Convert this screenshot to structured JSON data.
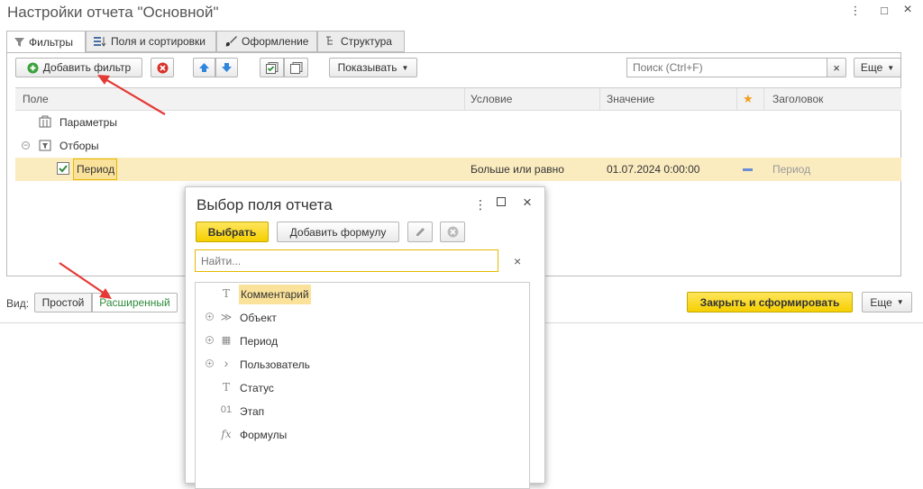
{
  "window": {
    "title": "Настройки отчета \"Основной\"",
    "more_icon": "⋮",
    "maximize_icon": "□",
    "close_icon": "×"
  },
  "tabs": [
    {
      "label": "Фильтры",
      "icon": "filter-icon",
      "active": true
    },
    {
      "label": "Поля и сортировки",
      "icon": "fields-icon",
      "active": false
    },
    {
      "label": "Оформление",
      "icon": "brush-icon",
      "active": false
    },
    {
      "label": "Структура",
      "icon": "structure-icon",
      "active": false
    }
  ],
  "toolbar": {
    "add_filter_label": "Добавить фильтр",
    "show_label": "Показывать",
    "search_placeholder": "Поиск (Ctrl+F)",
    "more_label": "Еще"
  },
  "grid": {
    "columns": {
      "field": "Поле",
      "condition": "Условие",
      "value": "Значение",
      "title": "Заголовок"
    },
    "rows": {
      "params": "Параметры",
      "filters": "Отборы",
      "period_field": "Период",
      "period_condition": "Больше или равно",
      "period_value": "01.07.2024 0:00:00",
      "period_title": "Период"
    }
  },
  "bottom": {
    "view_label": "Вид:",
    "simple": "Простой",
    "advanced": "Расширенный",
    "close_generate": "Закрыть и сформировать",
    "more_label": "Еще"
  },
  "popup": {
    "title": "Выбор поля отчета",
    "select_label": "Выбрать",
    "add_formula_label": "Добавить формулу",
    "find_placeholder": "Найти...",
    "clear_icon": "×",
    "items": [
      {
        "label": "Комментарий",
        "icon": "T",
        "expandable": false,
        "selected": true
      },
      {
        "label": "Объект",
        "icon": "≫",
        "expandable": true,
        "selected": false
      },
      {
        "label": "Период",
        "icon": "▦",
        "expandable": true,
        "selected": false
      },
      {
        "label": "Пользователь",
        "icon": "›",
        "expandable": true,
        "selected": false
      },
      {
        "label": "Статус",
        "icon": "T",
        "expandable": false,
        "selected": false
      },
      {
        "label": "Этап",
        "icon": "01",
        "expandable": false,
        "selected": false
      },
      {
        "label": "Формулы",
        "icon": "fx",
        "expandable": false,
        "selected": false
      }
    ]
  },
  "colors": {
    "accent_yellow": "#f5cf00",
    "selection": "#fbecc0",
    "annotation_arrow": "#e53935",
    "advanced_green": "#2e8b3a"
  }
}
